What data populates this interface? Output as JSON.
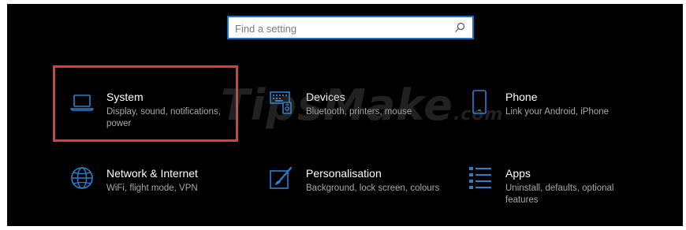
{
  "search": {
    "placeholder": "Find a setting",
    "icon": "search-icon"
  },
  "tiles": [
    {
      "title": "System",
      "desc": "Display, sound, notifications, power",
      "icon": "laptop-icon"
    },
    {
      "title": "Devices",
      "desc": "Bluetooth, printers, mouse",
      "icon": "keyboard-devices-icon"
    },
    {
      "title": "Phone",
      "desc": "Link your Android, iPhone",
      "icon": "phone-icon"
    },
    {
      "title": "Network & Internet",
      "desc": "WiFi, flight mode, VPN",
      "icon": "globe-icon"
    },
    {
      "title": "Personalisation",
      "desc": "Background, lock screen, colours",
      "icon": "paint-brush-icon"
    },
    {
      "title": "Apps",
      "desc": "Uninstall, defaults, optional features",
      "icon": "apps-list-icon"
    }
  ],
  "watermark": {
    "text": "TipsMake",
    "domain": ".com"
  },
  "colors": {
    "accent": "#2a7fd4",
    "background": "#000000",
    "highlight": "#e23b3b",
    "title_text": "#ffffff",
    "desc_text": "#a8a8a8"
  }
}
